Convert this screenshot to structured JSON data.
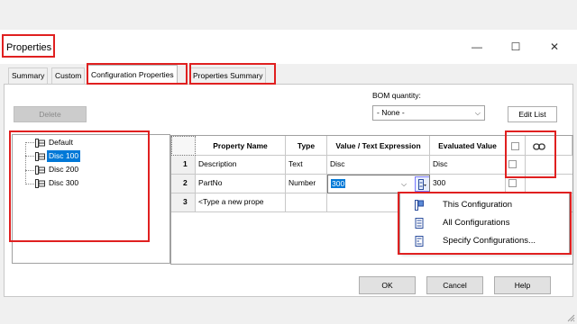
{
  "window": {
    "title": "Properties",
    "minimize_glyph": "—",
    "maximize_glyph": "☐",
    "close_glyph": "✕"
  },
  "tabs": [
    {
      "label": "Summary",
      "active": false
    },
    {
      "label": "Custom",
      "active": false
    },
    {
      "label": "Configuration Properties",
      "active": true
    },
    {
      "label": "Properties Summary",
      "active": false
    }
  ],
  "toolbar": {
    "delete_label": "Delete",
    "bom_label": "BOM quantity:",
    "bom_value": "- None -",
    "edit_list_label": "Edit List"
  },
  "tree": {
    "items": [
      {
        "label": "Default",
        "selected": false
      },
      {
        "label": "Disc 100",
        "selected": true
      },
      {
        "label": "Disc 200",
        "selected": false
      },
      {
        "label": "Disc 300",
        "selected": false
      }
    ]
  },
  "grid": {
    "headers": [
      "Property Name",
      "Type",
      "Value / Text Expression",
      "Evaluated Value"
    ],
    "link_icon": "link-icon",
    "rows": [
      {
        "num": "1",
        "name": "Description",
        "type": "Text",
        "value": "Disc",
        "evaluated": "Disc"
      },
      {
        "num": "2",
        "name": "PartNo",
        "type": "Number",
        "value": "300",
        "evaluated": "300"
      },
      {
        "num": "3",
        "name": "<Type a new prope",
        "type": "",
        "value": "",
        "evaluated": ""
      }
    ]
  },
  "popup_menu": {
    "items": [
      {
        "label": "This Configuration",
        "icon": "this-config-icon"
      },
      {
        "label": "All Configurations",
        "icon": "all-configs-icon"
      },
      {
        "label": "Specify Configurations...",
        "icon": "specify-configs-icon"
      }
    ]
  },
  "footer": {
    "ok_label": "OK",
    "cancel_label": "Cancel",
    "help_label": "Help"
  },
  "colors": {
    "highlight": "#e02020",
    "selection": "#0078d7"
  }
}
